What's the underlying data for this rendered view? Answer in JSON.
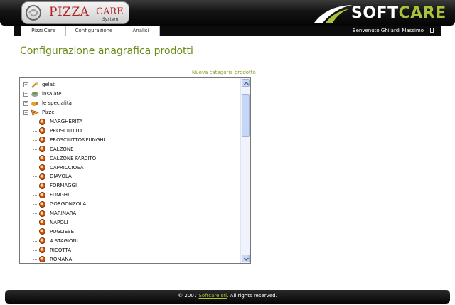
{
  "header": {
    "logo_main": "PIZZA",
    "logo_care": "CARE",
    "logo_sub": "System",
    "brand_soft": "SOFT",
    "brand_care": "CARE",
    "tabs": [
      {
        "label": "PizzaCare"
      },
      {
        "label": "Configurazione"
      },
      {
        "label": "Analisi"
      }
    ],
    "welcome": "Benvenuto Ghilardi Massimo"
  },
  "main": {
    "title": "Configurazione anagrafica prodotti",
    "new_category_link": "Nuova categoria prodotto"
  },
  "tree": {
    "categories": [
      {
        "label": "gelati",
        "expander": "+",
        "icon": "ice-cream-icon"
      },
      {
        "label": "insalate",
        "expander": "+",
        "icon": "salad-bowl-icon"
      },
      {
        "label": "le specialità",
        "expander": "+",
        "icon": "specialty-icon"
      },
      {
        "label": "Pizze",
        "expander": "−",
        "icon": "pizza-slice-icon"
      }
    ],
    "pizzas": [
      "MARGHERITA",
      "PROSCIUTTO",
      "PROSCIUTTO&FUNGHI",
      "CALZONE",
      "CALZONE FARCITO",
      "CAPRICCIOSA",
      "DIAVOLA",
      "FORMAGGI",
      "FUNGHI",
      "GORGONZOLA",
      "MARINARA",
      "NAPOLI",
      "PUGLIESE",
      "4 STAGIONI",
      "RICOTTA",
      "ROMANA"
    ],
    "item_icon": "pizza-icon"
  },
  "footer": {
    "prefix": "© 2007 ",
    "link": "Softcare srl",
    "suffix": ". All rights reserved."
  },
  "colors": {
    "accent": "#6c8a16",
    "brand_green": "#a8c23a",
    "logo_red": "#b02020"
  }
}
